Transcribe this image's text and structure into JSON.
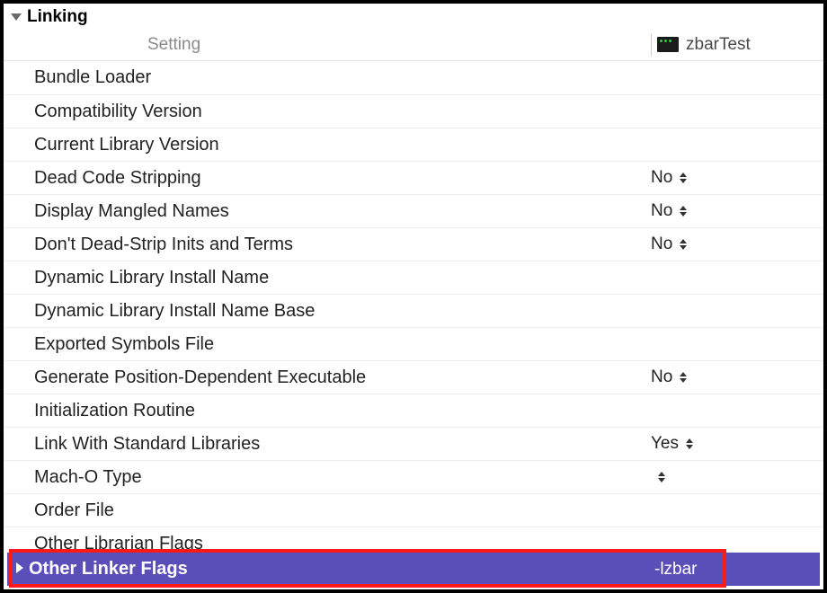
{
  "section": {
    "title": "Linking"
  },
  "columns": {
    "setting_header": "Setting",
    "target_name": "zbarTest"
  },
  "rows": [
    {
      "label": "Bundle Loader",
      "value": "",
      "has_stepper": false
    },
    {
      "label": "Compatibility Version",
      "value": "",
      "has_stepper": false
    },
    {
      "label": "Current Library Version",
      "value": "",
      "has_stepper": false
    },
    {
      "label": "Dead Code Stripping",
      "value": "No",
      "has_stepper": true
    },
    {
      "label": "Display Mangled Names",
      "value": "No",
      "has_stepper": true
    },
    {
      "label": "Don't Dead-Strip Inits and Terms",
      "value": "No",
      "has_stepper": true
    },
    {
      "label": "Dynamic Library Install Name",
      "value": "",
      "has_stepper": false
    },
    {
      "label": "Dynamic Library Install Name Base",
      "value": "",
      "has_stepper": false
    },
    {
      "label": "Exported Symbols File",
      "value": "",
      "has_stepper": false
    },
    {
      "label": "Generate Position-Dependent Executable",
      "value": "No",
      "has_stepper": true
    },
    {
      "label": "Initialization Routine",
      "value": "",
      "has_stepper": false
    },
    {
      "label": "Link With Standard Libraries",
      "value": "Yes",
      "has_stepper": true
    },
    {
      "label": "Mach-O Type",
      "value": "",
      "has_stepper": true
    },
    {
      "label": "Order File",
      "value": "",
      "has_stepper": false
    },
    {
      "label": "Other Librarian Flags",
      "value": "",
      "has_stepper": false
    }
  ],
  "selected_row": {
    "label": "Other Linker Flags",
    "value": "-lzbar"
  }
}
